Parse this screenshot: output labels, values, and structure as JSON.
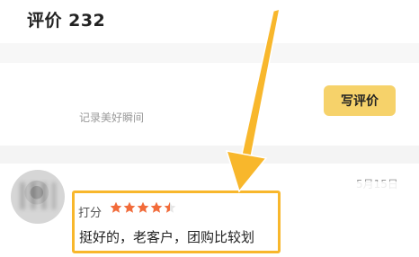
{
  "header": {
    "title": "评价 232"
  },
  "compose": {
    "placeholder": "记录美好瞬间",
    "write_button": "写评价"
  },
  "review": {
    "date": "5月15日",
    "score_label": "打分",
    "rating": 4.5,
    "rating_max": 5,
    "content": "挺好的，老客户，团购比较划"
  },
  "colors": {
    "accent_button": "#f6d26a",
    "highlight": "#f8b72c",
    "star": "#f26b3a"
  }
}
